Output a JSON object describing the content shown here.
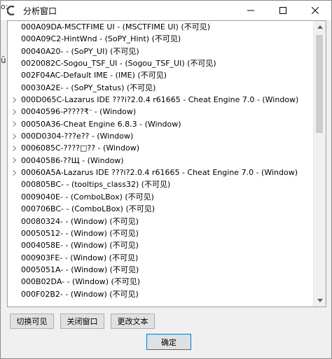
{
  "window": {
    "title": "分析窗口"
  },
  "behind": {
    "sliver": "o:",
    "letter": "ū"
  },
  "tree": {
    "items": [
      {
        "text": "000A09DA-MSCTFIME UI - (MSCTFIME UI) (不可见)",
        "expandable": false
      },
      {
        "text": "000A09C2-HintWnd - (SoPY_Hint) (不可见)",
        "expandable": false
      },
      {
        "text": "00040A20- - (SoPY_UI) (不可见)",
        "expandable": false
      },
      {
        "text": "0020082C-Sogou_TSF_UI - (Sogou_TSF_UI) (不可见)",
        "expandable": false
      },
      {
        "text": "002F04AC-Default IME - (IME) (不可见)",
        "expandable": false
      },
      {
        "text": "00030A2E- - (SoPY_Status) (不可见)",
        "expandable": false
      },
      {
        "text": "000D065C-Lazarus IDE ???i?2.0.4 r61665 - Cheat Engine 7.0 - (Window)",
        "expandable": true
      },
      {
        "text": "00040596-ᕈ????₹ᐨ - (Window)",
        "expandable": true
      },
      {
        "text": "00050A36-Cheat Engine 6.8.3 - (Window)",
        "expandable": true
      },
      {
        "text": "000D0304-???e?? - (Window)",
        "expandable": true
      },
      {
        "text": "0006085C-????□?? - (Window)",
        "expandable": true
      },
      {
        "text": "00040586-??Щ - (Window)",
        "expandable": true
      },
      {
        "text": "00060A5A-Lazarus IDE ???i?2.0.4 r61665 - Cheat Engine 7.0 - (Window)",
        "expandable": true
      },
      {
        "text": "000805BC- - (tooltips_class32) (不可见)",
        "expandable": false
      },
      {
        "text": "0009040E- - (ComboLBox) (不可见)",
        "expandable": false
      },
      {
        "text": "000706BC- - (ComboLBox) (不可见)",
        "expandable": false
      },
      {
        "text": "00080324- - (Window) (不可见)",
        "expandable": false
      },
      {
        "text": "00050512- - (Window) (不可见)",
        "expandable": false
      },
      {
        "text": "0004058E- - (Window) (不可见)",
        "expandable": false
      },
      {
        "text": "000903FE- - (Window) (不可见)",
        "expandable": false
      },
      {
        "text": "0005051A- - (Window) (不可见)",
        "expandable": false
      },
      {
        "text": "000B02DA- - (Window) (不可见)",
        "expandable": false
      },
      {
        "text": "000F02B2- - (Window) (不可见)",
        "expandable": false
      },
      {
        "text": "",
        "expandable": false
      }
    ]
  },
  "buttons": {
    "toggle_visible": "切换可见",
    "close_window": "关闭窗口",
    "change_text": "更改文本",
    "ok": "确定"
  },
  "colors": {
    "window_bg": "#f0f0f0",
    "button_bg": "#e1e1e1",
    "button_border": "#adadad",
    "ok_border": "#0078d7",
    "scroll_thumb": "#cdcdcd"
  }
}
